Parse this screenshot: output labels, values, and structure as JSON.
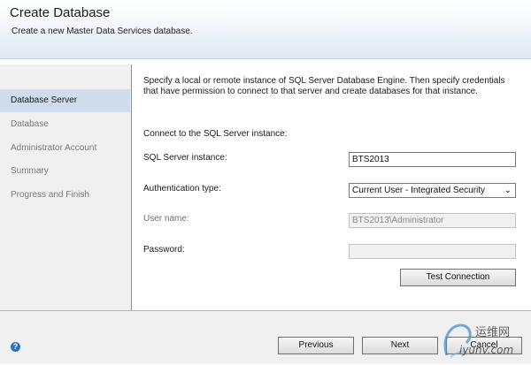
{
  "header": {
    "title": "Create Database",
    "subtitle": "Create a new Master Data Services database."
  },
  "sidebar": {
    "items": [
      {
        "label": "Database Server",
        "active": true
      },
      {
        "label": "Database",
        "active": false
      },
      {
        "label": "Administrator Account",
        "active": false
      },
      {
        "label": "Summary",
        "active": false
      },
      {
        "label": "Progress and Finish",
        "active": false
      }
    ]
  },
  "main": {
    "description": "Specify a local or remote instance of SQL Server Database Engine. Then specify credentials that have permission to connect to that server and create databases for that instance.",
    "connect_heading": "Connect to the SQL Server instance:",
    "instance": {
      "label": "SQL Server instance:",
      "value": "BTS2013"
    },
    "auth": {
      "label": "Authentication type:",
      "value": "Current User - Integrated Security"
    },
    "username": {
      "label": "User name:",
      "value": "BTS2013\\Administrator"
    },
    "password": {
      "label": "Password:",
      "value": ""
    },
    "test_button": "Test Connection"
  },
  "footer": {
    "help_icon": "?",
    "previous": "Previous",
    "next": "Next",
    "cancel": "Cancel"
  },
  "watermark": {
    "line1": "运维网",
    "line2": "iyunv.com"
  }
}
